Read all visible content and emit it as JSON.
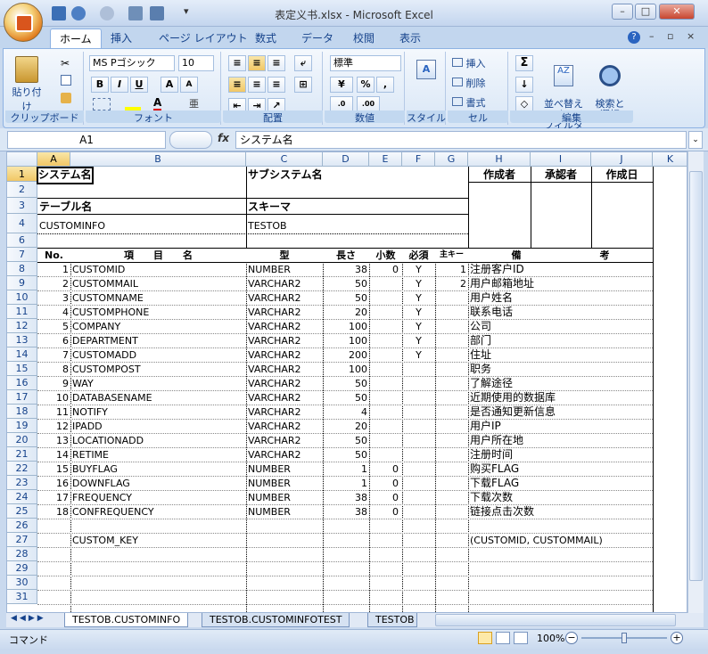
{
  "window": {
    "title": "表定义书.xlsx - Microsoft Excel",
    "minimize": "–",
    "maximize": "□",
    "close": "✕"
  },
  "ribbon_tabs": [
    "ホーム",
    "挿入",
    "ページ レイアウト",
    "数式",
    "データ",
    "校閲",
    "表示"
  ],
  "ribbon": {
    "clipboard": {
      "paste": "貼り付け",
      "label": "クリップボード"
    },
    "font": {
      "name": "MS Pゴシック",
      "size": "10",
      "bold": "B",
      "italic": "I",
      "underline": "U",
      "grow": "A",
      "shrink": "A",
      "label": "フォント"
    },
    "alignment": {
      "label": "配置"
    },
    "number": {
      "format": "標準",
      "percent": "%",
      "comma": ",",
      "label": "数値"
    },
    "styles": {
      "label": "スタイル"
    },
    "cells": {
      "insert": "挿入",
      "delete": "削除",
      "format": "書式",
      "label": "セル"
    },
    "editing": {
      "sum": "Σ",
      "sort": "並べ替えと\nフィルタ",
      "find": "検索と\n選択",
      "label": "編集"
    }
  },
  "formula_bar": {
    "name_box": "A1",
    "fx": "fx",
    "content": "システム名"
  },
  "columns": [
    "A",
    "B",
    "C",
    "D",
    "E",
    "F",
    "G",
    "H",
    "I",
    "J",
    "K"
  ],
  "header_block": {
    "system_name_label": "システム名",
    "subsystem_label": "サブシステム名",
    "author": "作成者",
    "approver": "承認者",
    "created": "作成日",
    "table_name_label": "テーブル名",
    "schema_label": "スキーマ",
    "table_name": "CUSTOMINFO",
    "schema": "TESTOB"
  },
  "table_headers": {
    "no": "No.",
    "name": "項　　目　　名",
    "type": "型",
    "length": "長さ",
    "decimal": "小数",
    "required": "必須",
    "pk": "主キー",
    "note": "備　　　　　　　　考"
  },
  "rows": [
    {
      "no": "1",
      "name": "CUSTOMID",
      "type": "NUMBER",
      "len": "38",
      "dec": "0",
      "req": "Y",
      "pk": "1",
      "note": "注册客户ID"
    },
    {
      "no": "2",
      "name": "CUSTOMMAIL",
      "type": "VARCHAR2",
      "len": "50",
      "dec": "",
      "req": "Y",
      "pk": "2",
      "note": "用户邮箱地址"
    },
    {
      "no": "3",
      "name": "CUSTOMNAME",
      "type": "VARCHAR2",
      "len": "50",
      "dec": "",
      "req": "Y",
      "pk": "",
      "note": "用户姓名"
    },
    {
      "no": "4",
      "name": "CUSTOMPHONE",
      "type": "VARCHAR2",
      "len": "20",
      "dec": "",
      "req": "Y",
      "pk": "",
      "note": "联系电话"
    },
    {
      "no": "5",
      "name": "COMPANY",
      "type": "VARCHAR2",
      "len": "100",
      "dec": "",
      "req": "Y",
      "pk": "",
      "note": "公司"
    },
    {
      "no": "6",
      "name": "DEPARTMENT",
      "type": "VARCHAR2",
      "len": "100",
      "dec": "",
      "req": "Y",
      "pk": "",
      "note": "部门"
    },
    {
      "no": "7",
      "name": "CUSTOMADD",
      "type": "VARCHAR2",
      "len": "200",
      "dec": "",
      "req": "Y",
      "pk": "",
      "note": "住址"
    },
    {
      "no": "8",
      "name": "CUSTOMPOST",
      "type": "VARCHAR2",
      "len": "100",
      "dec": "",
      "req": "",
      "pk": "",
      "note": "职务"
    },
    {
      "no": "9",
      "name": "WAY",
      "type": "VARCHAR2",
      "len": "50",
      "dec": "",
      "req": "",
      "pk": "",
      "note": "了解途径"
    },
    {
      "no": "10",
      "name": "DATABASENAME",
      "type": "VARCHAR2",
      "len": "50",
      "dec": "",
      "req": "",
      "pk": "",
      "note": "近期使用的数据库"
    },
    {
      "no": "11",
      "name": "NOTIFY",
      "type": "VARCHAR2",
      "len": "4",
      "dec": "",
      "req": "",
      "pk": "",
      "note": "是否通知更新信息"
    },
    {
      "no": "12",
      "name": "IPADD",
      "type": "VARCHAR2",
      "len": "20",
      "dec": "",
      "req": "",
      "pk": "",
      "note": "用户IP"
    },
    {
      "no": "13",
      "name": "LOCATIONADD",
      "type": "VARCHAR2",
      "len": "50",
      "dec": "",
      "req": "",
      "pk": "",
      "note": "用户所在地"
    },
    {
      "no": "14",
      "name": "RETIME",
      "type": "VARCHAR2",
      "len": "50",
      "dec": "",
      "req": "",
      "pk": "",
      "note": "注册时间"
    },
    {
      "no": "15",
      "name": "BUYFLAG",
      "type": "NUMBER",
      "len": "1",
      "dec": "0",
      "req": "",
      "pk": "",
      "note": "购买FLAG"
    },
    {
      "no": "16",
      "name": "DOWNFLAG",
      "type": "NUMBER",
      "len": "1",
      "dec": "0",
      "req": "",
      "pk": "",
      "note": "下载FLAG"
    },
    {
      "no": "17",
      "name": "FREQUENCY",
      "type": "NUMBER",
      "len": "38",
      "dec": "0",
      "req": "",
      "pk": "",
      "note": "下载次数"
    },
    {
      "no": "18",
      "name": "CONFREQUENCY",
      "type": "NUMBER",
      "len": "38",
      "dec": "0",
      "req": "",
      "pk": "",
      "note": "链接点击次数"
    }
  ],
  "custom_key": {
    "label": "CUSTOM_KEY",
    "value": "(CUSTOMID, CUSTOMMAIL)"
  },
  "row_numbers": [
    "1",
    "2",
    "3",
    "4",
    "6",
    "7",
    "8",
    "9",
    "10",
    "11",
    "12",
    "13",
    "14",
    "15",
    "16",
    "17",
    "18",
    "19",
    "20",
    "21",
    "22",
    "23",
    "24",
    "25",
    "26",
    "27",
    "28",
    "29",
    "30",
    "31"
  ],
  "sheet_tabs": [
    "TESTOB.CUSTOMINFO",
    "TESTOB.CUSTOMINFOTEST",
    "TESTOB"
  ],
  "status": {
    "mode": "コマンド",
    "zoom": "100%"
  }
}
